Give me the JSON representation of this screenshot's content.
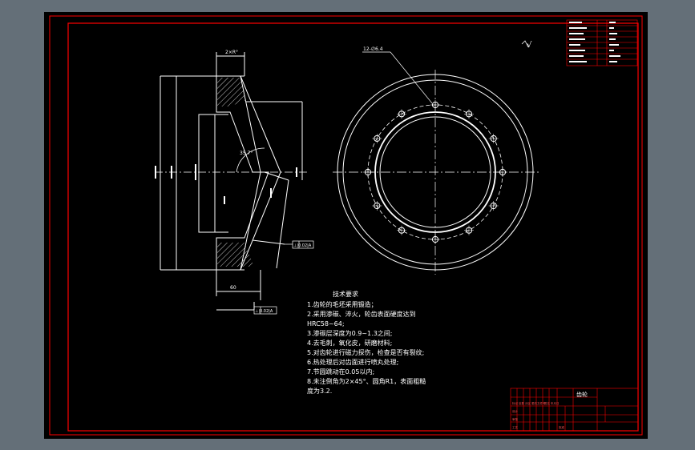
{
  "colors": {
    "background": "#646f78",
    "sheet": "#000000",
    "frame": "#ff0000",
    "lines": "#ffffff",
    "hatch": "#c0c0c0"
  },
  "drawing": {
    "top_dimension": "2×R°",
    "bolt_hole_callout": "12-∅6.4",
    "roughness_symbol": "√",
    "section_angle_label": "35.7°",
    "tolerance_frame_1": "⊥|0.02|A",
    "tolerance_frame_2": "⊥|0.02|A",
    "bottom_dimension": "60"
  },
  "tech_requirements": {
    "title": "技术要求",
    "lines": [
      "1.齿轮的毛坯采用锻造；",
      "  2.采用渗碳、淬火，轮齿表面硬度达到",
      "HRC58~64;",
      "  3.渗碳层深度为0.9~1.3之间;",
      "  4.去毛刺，氧化皮，研磨材料;",
      "  5.对齿轮进行磁力探伤，检查是否有裂纹;",
      "  6.热处理后对齿面进行喷丸处理;",
      "  7.节圆跳动在0.05以内;",
      "  8.未注倒角为2×45°、圆角R1，表面粗糙",
      "度为3.2."
    ]
  },
  "title_block": {
    "part_name": "齿轮",
    "drawing_no": "",
    "labels": [
      "标记",
      "处数",
      "分区",
      "更改文件号",
      "签名",
      "年月日",
      "设计",
      "审核",
      "工艺",
      "批准"
    ]
  }
}
